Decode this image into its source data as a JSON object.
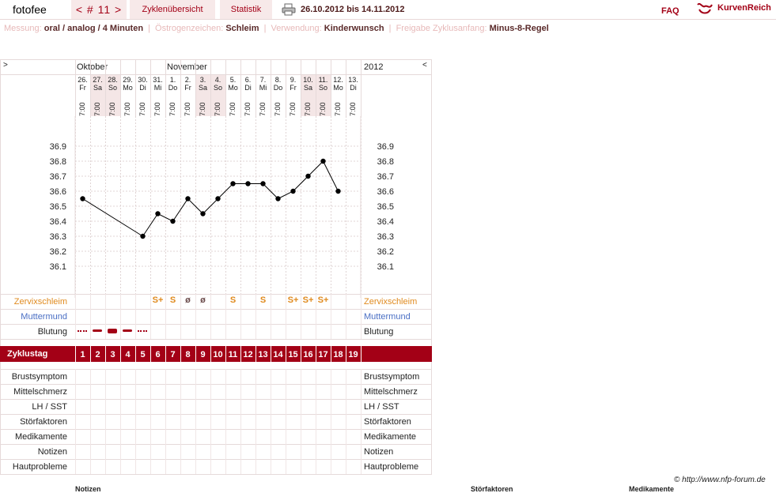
{
  "topbar": {
    "user": "fotofee",
    "cycle": "< # 11 >",
    "cycle_overview": "Zyklenübersicht",
    "statistics": "Statistik",
    "print_icon": "printer-icon",
    "date_range": "26.10.2012 bis 14.11.2012",
    "faq": "FAQ",
    "logo_icon": "kurvenreich-logo-icon",
    "logo": "KurvenReich"
  },
  "settings": {
    "messung_label": "Messung:",
    "messung_value": "oral / analog / 4 Minuten",
    "oestrogen_label": "Östrogenzeichen:",
    "oestrogen_value": "Schleim",
    "verwendung_label": "Verwendung:",
    "verwendung_value": "Kinderwunsch",
    "freigabe_label": "Freigabe Zyklusanfang:",
    "freigabe_value": "Minus-8-Regel"
  },
  "chart": {
    "nav_left": ">",
    "nav_right": "<",
    "month_1": "Oktober",
    "month_2": "November",
    "year": "2012",
    "days": [
      {
        "date": "26.",
        "wd": "Fr",
        "time": "7:00",
        "weekend": false
      },
      {
        "date": "27.",
        "wd": "Sa",
        "time": "7:00",
        "weekend": true
      },
      {
        "date": "28.",
        "wd": "So",
        "time": "7:00",
        "weekend": true
      },
      {
        "date": "29.",
        "wd": "Mo",
        "time": "7:00",
        "weekend": false
      },
      {
        "date": "30.",
        "wd": "Di",
        "time": "7:00",
        "weekend": false
      },
      {
        "date": "31.",
        "wd": "Mi",
        "time": "7:00",
        "weekend": false
      },
      {
        "date": "1.",
        "wd": "Do",
        "time": "7:00",
        "weekend": false
      },
      {
        "date": "2.",
        "wd": "Fr",
        "time": "7:00",
        "weekend": false
      },
      {
        "date": "3.",
        "wd": "Sa",
        "time": "7:00",
        "weekend": true
      },
      {
        "date": "4.",
        "wd": "So",
        "time": "7:00",
        "weekend": true
      },
      {
        "date": "5.",
        "wd": "Mo",
        "time": "7:00",
        "weekend": false
      },
      {
        "date": "6.",
        "wd": "Di",
        "time": "7:00",
        "weekend": false
      },
      {
        "date": "7.",
        "wd": "Mi",
        "time": "7:00",
        "weekend": false
      },
      {
        "date": "8.",
        "wd": "Do",
        "time": "7:00",
        "weekend": false
      },
      {
        "date": "9.",
        "wd": "Fr",
        "time": "7:00",
        "weekend": false
      },
      {
        "date": "10.",
        "wd": "Sa",
        "time": "7:00",
        "weekend": true
      },
      {
        "date": "11.",
        "wd": "So",
        "time": "7:00",
        "weekend": true
      },
      {
        "date": "12.",
        "wd": "Mo",
        "time": "7:00",
        "weekend": false
      },
      {
        "date": "13.",
        "wd": "Di",
        "time": "7:00",
        "weekend": false
      }
    ],
    "row_labels": {
      "zervix": "Zervixschleim",
      "muttermund": "Muttermund",
      "blutung": "Blutung",
      "zyklustag": "Zyklustag",
      "brust": "Brustsymptom",
      "mittel": "Mittelschmerz",
      "lh": "LH / SST",
      "stoer": "Störfaktoren",
      "medi": "Medikamente",
      "notizen": "Notizen",
      "haut": "Hautprobleme"
    },
    "zervix_values": [
      "",
      "",
      "",
      "",
      "",
      "S+",
      "S",
      "ø",
      "ø",
      "",
      "S",
      "",
      "S",
      "",
      "S+",
      "S+",
      "S+",
      "",
      ""
    ],
    "blutung_levels": [
      1,
      2,
      3,
      2,
      1,
      0,
      0,
      0,
      0,
      0,
      0,
      0,
      0,
      0,
      0,
      0,
      0,
      0,
      0
    ],
    "cycle_days": [
      "1",
      "2",
      "3",
      "4",
      "5",
      "6",
      "7",
      "8",
      "9",
      "10",
      "11",
      "12",
      "13",
      "14",
      "15",
      "16",
      "17",
      "18",
      "19"
    ],
    "colors": {
      "accent": "#a30016",
      "zervix": "#e08a1e",
      "muttermund": "#4a6fc4",
      "band": "#f8f1f1"
    }
  },
  "chart_data": {
    "type": "line",
    "title": "",
    "xlabel": "",
    "ylabel": "",
    "x": [
      "26.",
      "27.",
      "28.",
      "29.",
      "30.",
      "31.",
      "1.",
      "2.",
      "3.",
      "4.",
      "5.",
      "6.",
      "7.",
      "8.",
      "9.",
      "10.",
      "11.",
      "12.",
      "13."
    ],
    "y_ticks": [
      "36.9",
      "36.8",
      "36.7",
      "36.6",
      "36.5",
      "36.4",
      "36.3",
      "36.2",
      "36.1"
    ],
    "ylim": [
      36.1,
      36.9
    ],
    "grid": true,
    "series": [
      {
        "values": [
          36.55,
          null,
          null,
          null,
          36.3,
          36.45,
          36.4,
          36.55,
          36.45,
          36.55,
          36.65,
          36.65,
          36.65,
          36.55,
          36.6,
          36.7,
          36.8,
          36.6,
          null
        ]
      }
    ]
  },
  "footer": {
    "credit": "© http://www.nfp-forum.de",
    "below_1": "Notizen",
    "below_2": "Störfaktoren",
    "below_3": "Medikamente"
  }
}
